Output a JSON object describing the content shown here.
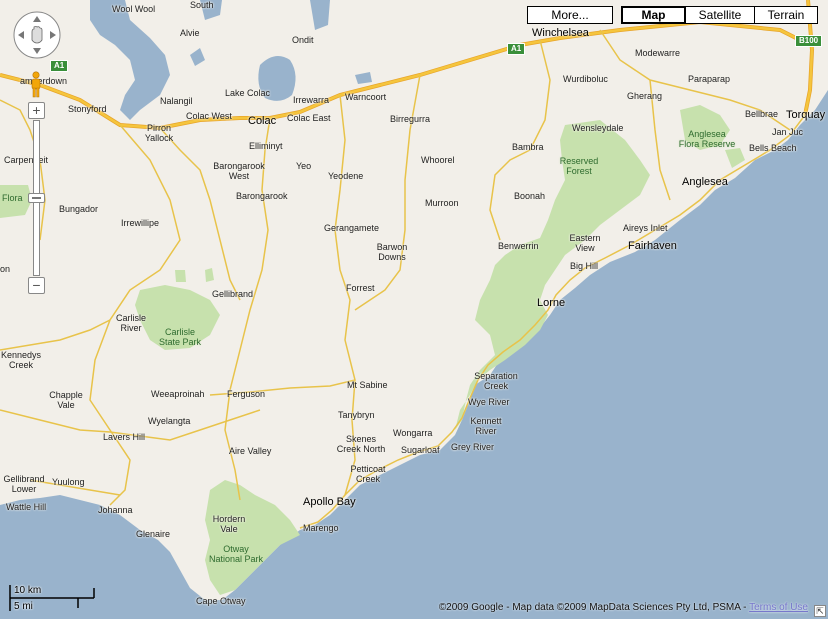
{
  "map_types": {
    "more": "More...",
    "map": "Map",
    "satellite": "Satellite",
    "terrain": "Terrain"
  },
  "places": [
    {
      "id": "wool-wool",
      "name": "Wool Wool"
    },
    {
      "id": "south",
      "name": "South"
    },
    {
      "id": "alvie",
      "name": "Alvie"
    },
    {
      "id": "ondit",
      "name": "Ondit"
    },
    {
      "id": "winchelsea",
      "name": "Winchelsea"
    },
    {
      "id": "modewarre",
      "name": "Modewarre"
    },
    {
      "id": "camperdown",
      "name": "amperdown"
    },
    {
      "id": "nalangil",
      "name": "Nalangil"
    },
    {
      "id": "lake-colac",
      "name": "Lake Colac"
    },
    {
      "id": "irrewarra",
      "name": "Irrewarra"
    },
    {
      "id": "warncoort",
      "name": "Warncoort"
    },
    {
      "id": "wurdiboluc",
      "name": "Wurdiboluc"
    },
    {
      "id": "paraparap",
      "name": "Paraparap"
    },
    {
      "id": "stonyford",
      "name": "Stonyford"
    },
    {
      "id": "gherang",
      "name": "Gherang"
    },
    {
      "id": "colac-west",
      "name": "Colac West"
    },
    {
      "id": "colac",
      "name": "Colac"
    },
    {
      "id": "colac-east",
      "name": "Colac East"
    },
    {
      "id": "birregurra",
      "name": "Birregurra"
    },
    {
      "id": "bellbrae",
      "name": "Bellbrae"
    },
    {
      "id": "torquay",
      "name": "Torquay"
    },
    {
      "id": "pirron-yallock",
      "name": "Pirron\nYallock"
    },
    {
      "id": "wensleydale",
      "name": "Wensleydale"
    },
    {
      "id": "jan-juc",
      "name": "Jan Juc"
    },
    {
      "id": "elliminyt",
      "name": "Elliminyt"
    },
    {
      "id": "anglesea-flora-reserve",
      "name": "Anglesea\nFlora Reserve"
    },
    {
      "id": "bambra",
      "name": "Bambra"
    },
    {
      "id": "bells-beach",
      "name": "Bells Beach"
    },
    {
      "id": "carpendeit",
      "name": "Carpendeit"
    },
    {
      "id": "barongarook-west",
      "name": "Barongarook\nWest"
    },
    {
      "id": "yeo",
      "name": "Yeo"
    },
    {
      "id": "whoorel",
      "name": "Whoorel"
    },
    {
      "id": "reserved-forest",
      "name": "Reserved\nForest"
    },
    {
      "id": "yeodene",
      "name": "Yeodene"
    },
    {
      "id": "anglesea",
      "name": "Anglesea"
    },
    {
      "id": "barongarook",
      "name": "Barongarook"
    },
    {
      "id": "boonah",
      "name": "Boonah"
    },
    {
      "id": "flora",
      "name": "Flora"
    },
    {
      "id": "bungador",
      "name": "Bungador"
    },
    {
      "id": "murroon",
      "name": "Murroon"
    },
    {
      "id": "irrewillipe",
      "name": "Irrewillipe"
    },
    {
      "id": "gerangamete",
      "name": "Gerangamete"
    },
    {
      "id": "aireys-inlet",
      "name": "Aireys Inlet"
    },
    {
      "id": "eastern-view",
      "name": "Eastern\nView"
    },
    {
      "id": "benwerrin",
      "name": "Benwerrin"
    },
    {
      "id": "fairhaven",
      "name": "Fairhaven"
    },
    {
      "id": "barwon-downs",
      "name": "Barwon\nDowns"
    },
    {
      "id": "big-hill",
      "name": "Big Hill"
    },
    {
      "id": "on",
      "name": "on"
    },
    {
      "id": "gellibrand",
      "name": "Gellibrand"
    },
    {
      "id": "forrest",
      "name": "Forrest"
    },
    {
      "id": "lorne",
      "name": "Lorne"
    },
    {
      "id": "carlisle-river",
      "name": "Carlisle\nRiver"
    },
    {
      "id": "carlisle-state-park",
      "name": "Carlisle\nState Park"
    },
    {
      "id": "kennedys-creek",
      "name": "Kennedys\nCreek"
    },
    {
      "id": "separation-creek",
      "name": "Separation\nCreek"
    },
    {
      "id": "mt-sabine",
      "name": "Mt Sabine"
    },
    {
      "id": "weeaproinah",
      "name": "Weeaproinah"
    },
    {
      "id": "ferguson",
      "name": "Ferguson"
    },
    {
      "id": "chapple-vale",
      "name": "Chapple\nVale"
    },
    {
      "id": "wye-river",
      "name": "Wye River"
    },
    {
      "id": "tanybryn",
      "name": "Tanybryn"
    },
    {
      "id": "wyelangta",
      "name": "Wyelangta"
    },
    {
      "id": "kennett-river",
      "name": "Kennett\nRiver"
    },
    {
      "id": "wongarra",
      "name": "Wongarra"
    },
    {
      "id": "lavers-hill",
      "name": "Lavers Hill"
    },
    {
      "id": "skenes-creek-north",
      "name": "Skenes\nCreek North"
    },
    {
      "id": "grey-river",
      "name": "Grey River"
    },
    {
      "id": "sugarloaf",
      "name": "Sugarloaf"
    },
    {
      "id": "aire-valley",
      "name": "Aire Valley"
    },
    {
      "id": "petticoat-creek",
      "name": "Petticoat\nCreek"
    },
    {
      "id": "gellibrand-lower",
      "name": "Gellibrand\nLower"
    },
    {
      "id": "yuulong",
      "name": "Yuulong"
    },
    {
      "id": "apollo-bay",
      "name": "Apollo Bay"
    },
    {
      "id": "wattle-hill",
      "name": "Wattle Hill"
    },
    {
      "id": "johanna",
      "name": "Johanna"
    },
    {
      "id": "hordern-vale",
      "name": "Hordern\nVale"
    },
    {
      "id": "marengo",
      "name": "Marengo"
    },
    {
      "id": "glenaire",
      "name": "Glenaire"
    },
    {
      "id": "otway-national-park",
      "name": "Otway\nNational Park"
    },
    {
      "id": "cape-otway",
      "name": "Cape Otway"
    }
  ],
  "road_shields": {
    "a1_west": "A1",
    "a1_east": "A1",
    "b100": "B100"
  },
  "scale": {
    "km": "10 km",
    "mi": "5 mi"
  },
  "copyright": {
    "text": "©2009 Google - Map data ©2009 MapData Sciences Pty Ltd, PSMA - ",
    "terms": "Terms of Use"
  },
  "colors": {
    "land": "#f2efe9",
    "water": "#99b3cc",
    "park": "#c7e1ad",
    "road_major": "#f5c53d",
    "road_minor": "#f7df8a"
  },
  "icons": {
    "pan": "pan-control-icon",
    "pegman": "street-view-pegman-icon",
    "zoom_in": "+",
    "zoom_out": "−",
    "corner": "⇱"
  }
}
